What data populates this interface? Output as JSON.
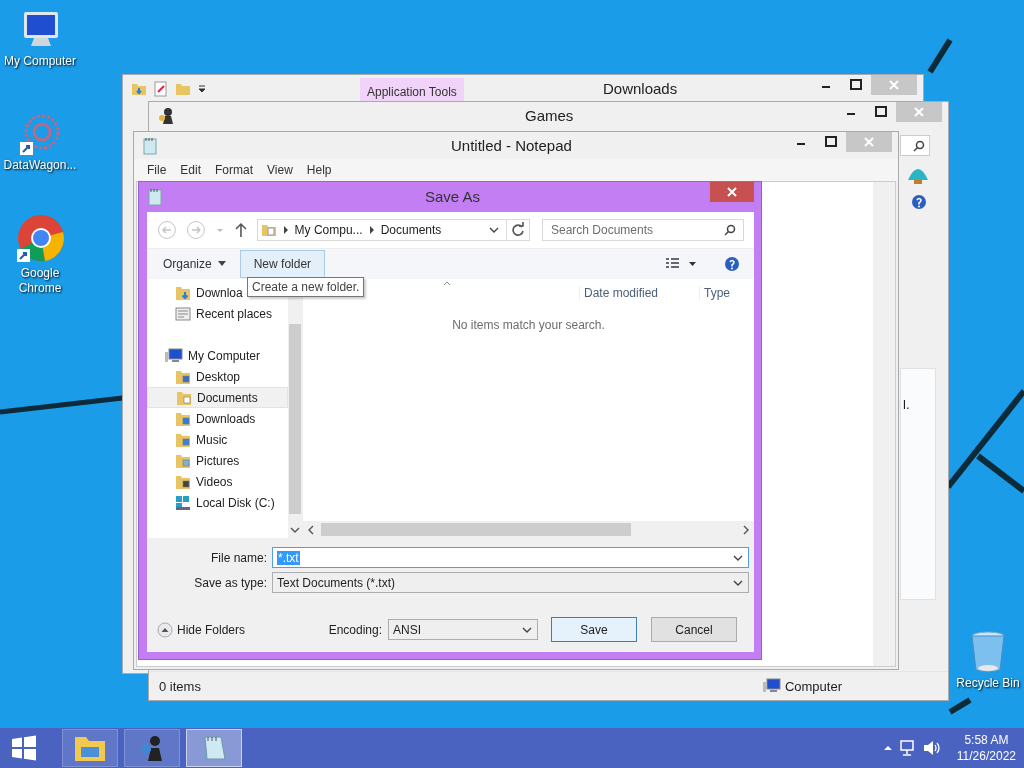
{
  "desktop_icons": [
    {
      "label": "My Computer",
      "kind": "computer"
    },
    {
      "label": "DataWagon...",
      "kind": "app"
    },
    {
      "label": "Google Chrome",
      "kind": "browser"
    },
    {
      "label": "Recycle Bin",
      "kind": "bin"
    }
  ],
  "downloads_window": {
    "title": "Downloads",
    "ribbon_tab": "Application Tools"
  },
  "games_window": {
    "title": "Games",
    "panel_text": "l.",
    "status_bar": {
      "items": "0 items",
      "location": "Computer"
    }
  },
  "notepad_window": {
    "title": "Untitled - Notepad",
    "menu": [
      "File",
      "Edit",
      "Format",
      "View",
      "Help"
    ]
  },
  "save_dialog": {
    "title": "Save As",
    "breadcrumb": [
      "My Compu...",
      "Documents"
    ],
    "search": {
      "placeholder": "Search Documents"
    },
    "toolbar": {
      "organize": "Organize",
      "new_folder": "New folder"
    },
    "tooltip": "Create a new folder.",
    "favorites": [
      {
        "label": "Downloa",
        "kind": "downloads",
        "selected": false
      },
      {
        "label": "Recent places",
        "kind": "recent",
        "selected": false
      }
    ],
    "tree": [
      {
        "label": "My Computer",
        "kind": "computer",
        "selected": false,
        "children": [
          {
            "label": "Desktop",
            "kind": "desktop",
            "selected": false
          },
          {
            "label": "Documents",
            "kind": "documents",
            "selected": true
          },
          {
            "label": "Downloads",
            "kind": "downloads",
            "selected": false
          },
          {
            "label": "Music",
            "kind": "music",
            "selected": false
          },
          {
            "label": "Pictures",
            "kind": "pictures",
            "selected": false
          },
          {
            "label": "Videos",
            "kind": "videos",
            "selected": false
          },
          {
            "label": "Local Disk (C:)",
            "kind": "disk",
            "selected": false
          }
        ]
      }
    ],
    "columns": [
      "Date modified",
      "Type"
    ],
    "empty_message": "No items match your search.",
    "file_name": {
      "label": "File name:",
      "value": "*.txt"
    },
    "save_type": {
      "label": "Save as type:",
      "value": "Text Documents (*.txt)"
    },
    "hide_folders": "Hide Folders",
    "encoding": {
      "label": "Encoding:",
      "value": "ANSI"
    },
    "buttons": [
      "Save",
      "Cancel"
    ]
  },
  "taskbar": {
    "apps": [
      {
        "kind": "explorer",
        "selected": false
      },
      {
        "kind": "games",
        "selected": false
      },
      {
        "kind": "notepad",
        "selected": true
      }
    ],
    "time": "5:58 AM",
    "date": "11/26/2022"
  }
}
